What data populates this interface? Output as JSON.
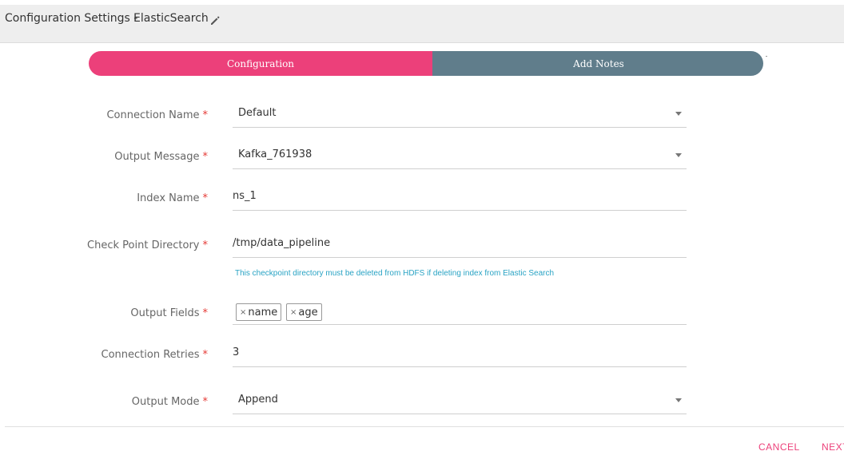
{
  "header": {
    "title_prefix": "Configuration Settings -",
    "component_name": "ElasticSearch"
  },
  "stepper": {
    "steps": [
      {
        "label": "Configuration",
        "active": true
      },
      {
        "label": "Add Notes",
        "active": false
      }
    ]
  },
  "form": {
    "required_marker": "*",
    "connection_name": {
      "label": "Connection Name",
      "value": "Default"
    },
    "output_message": {
      "label": "Output Message",
      "value": "Kafka_761938"
    },
    "index_name": {
      "label": "Index Name",
      "value": "ns_1"
    },
    "checkpoint_directory": {
      "label": "Check Point Directory",
      "value": "/tmp/data_pipeline",
      "hint": "This checkpoint directory must be deleted from HDFS if deleting index from Elastic Search"
    },
    "output_fields": {
      "label": "Output Fields",
      "chip_remove": "×",
      "chips": [
        "name",
        "age"
      ]
    },
    "connection_retries": {
      "label": "Connection Retries",
      "value": "3"
    },
    "output_mode": {
      "label": "Output Mode",
      "value": "Append"
    }
  },
  "footer": {
    "cancel_label": "CANCEL",
    "next_label": "NEXT"
  },
  "colors": {
    "accent": "#ec407a",
    "step_inactive": "#607d8b",
    "hint": "#29a3c4",
    "required": "#e53935"
  },
  "icons": {
    "edit": "pencil-icon",
    "dropdown": "caret-down-icon",
    "chip_remove": "close-icon"
  }
}
